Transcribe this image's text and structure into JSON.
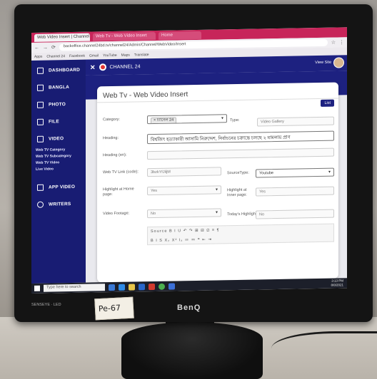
{
  "browser": {
    "tabs": [
      "Web Video Insert | Channel",
      "Web Tv - Web Video Insert",
      "Home"
    ],
    "url": "backoffice.channel24bd.tv/channel24/Admin/Channel/WebVideo/Insert",
    "bookmarks": [
      "Apps",
      "Channel 24",
      "Facebook",
      "Gmail",
      "YouTube",
      "Maps",
      "Translate"
    ]
  },
  "sidebar": {
    "items": [
      {
        "label": "DASHBOARD",
        "icon": "grid-icon"
      },
      {
        "label": "BANGLA",
        "icon": "edit-icon"
      },
      {
        "label": "PHOTO",
        "icon": "image-icon"
      },
      {
        "label": "FILE",
        "icon": "file-icon"
      },
      {
        "label": "VIDEO",
        "icon": "video-icon"
      }
    ],
    "video_sub": [
      "Web TV Category",
      "Web TV Subcategory",
      "Web TV Video",
      "Live Video"
    ],
    "items2": [
      {
        "label": "APP VIDEO",
        "icon": "video-icon"
      },
      {
        "label": "WRITERS",
        "icon": "user-icon"
      }
    ]
  },
  "topbar": {
    "brand": "CHANNEL 24",
    "view_site": "View Site"
  },
  "form": {
    "title": "Web Tv - Web Video Insert",
    "list_button": "List",
    "category_label": "Category:",
    "category_value": "× চ্যানেল 24",
    "type_label": "Type:",
    "type_value": "Video Gallery",
    "heading_label": "Heading:",
    "heading_value": "বিশ্বজিৎ হত্যাকারী আসামি নিরুদ্দেশ, নির্বাচনের চক্রান্তে চলছে ২ মামলায় প্রাণ",
    "heading_en_label": "Heading (en):",
    "webtv_link_label": "Web TV Link (code):",
    "webtv_link_value": "3bzkYfJiljM",
    "source_type_label": "SourceType:",
    "source_type_value": "Youtube",
    "highlight_home_label": "Highlight at Home page:",
    "highlight_home_value": "Yes",
    "highlight_inner_label": "Highlight at Inner page:",
    "highlight_inner_value": "Yes",
    "video_footage_label": "Video Footage:",
    "video_footage_value": "No",
    "todays_highlight_label": "Today's Highlight:",
    "todays_highlight_value": "No",
    "editor_row1": "Source  B  I  U  ↶ ↷  ⊞ ⊟  Ω  ≡  ¶",
    "editor_row2": "B  I  S  X₂  X²  Iₓ  ≔  ≕  ❝  ⇤ ⇥"
  },
  "taskbar": {
    "search": "Type here to search",
    "time": "3:13 PM",
    "date": "8/8/2021"
  },
  "monitor": {
    "brand": "BenQ",
    "model": "SENSEYE · LED",
    "note": "Pe-67"
  },
  "colors": {
    "sidebar": "#181c73",
    "tabstrip": "#c7255a",
    "accent": "#1d2180"
  }
}
